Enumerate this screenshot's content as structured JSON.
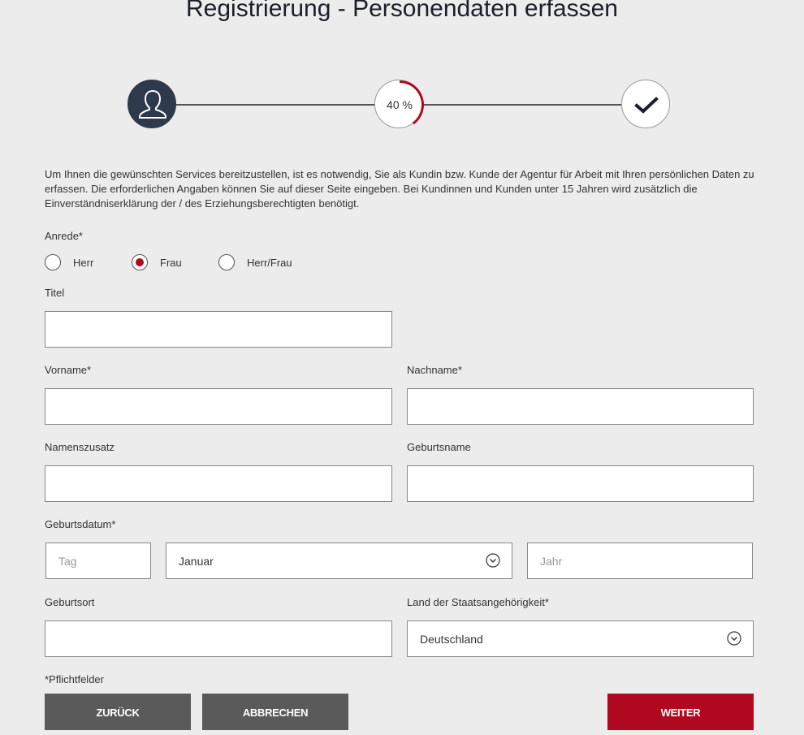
{
  "page": {
    "title": "Registrierung - Personendaten erfassen",
    "accent_color": "#b0081e",
    "dark_color": "#2d3a4b"
  },
  "stepper": {
    "progress_label": "40 %",
    "progress_fraction": 0.4,
    "steps": [
      {
        "icon": "user-icon",
        "state": "active"
      },
      {
        "icon": "progress-ring",
        "state": "in-progress"
      },
      {
        "icon": "checkmark-icon",
        "state": "pending"
      }
    ]
  },
  "intro_text": "Um Ihnen die gewünschten Services bereitzustellen, ist es notwendig, Sie als Kundin bzw. Kunde der Agentur für Arbeit mit Ihren persönlichen Daten zu erfassen. Die erforderlichen Angaben können Sie auf dieser Seite eingeben. Bei Kundinnen und Kunden unter 15 Jahren wird zusätzlich die Einverständniserklärung der / des Erziehungsberechtigten benötigt.",
  "form": {
    "anrede_label": "Anrede*",
    "anrede_options": [
      "Herr",
      "Frau",
      "Herr/Frau"
    ],
    "anrede_selected": "Frau",
    "titel_label": "Titel",
    "titel_value": "",
    "vorname_label": "Vorname*",
    "vorname_value": "",
    "nachname_label": "Nachname*",
    "nachname_value": "",
    "namenszusatz_label": "Namenszusatz",
    "namenszusatz_value": "",
    "geburtsname_label": "Geburtsname",
    "geburtsname_value": "",
    "geburtsdatum_label": "Geburtsdatum*",
    "tag_placeholder": "Tag",
    "monat_selected": "Januar",
    "jahr_placeholder": "Jahr",
    "geburtsort_label": "Geburtsort",
    "geburtsort_value": "",
    "staatsangehoerigkeit_label": "Land der Staatsangehörigkeit*",
    "staatsangehoerigkeit_selected": "Deutschland",
    "pflichtfelder_note": "*Pflichtfelder"
  },
  "buttons": {
    "back": "ZURÜCK",
    "cancel": "ABBRECHEN",
    "next": "WEITER"
  }
}
